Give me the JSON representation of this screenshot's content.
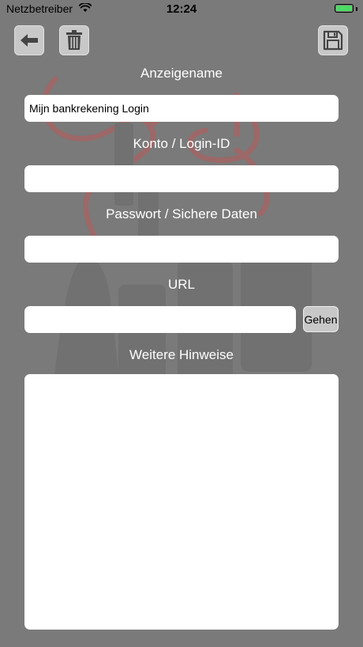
{
  "status_bar": {
    "carrier": "Netzbetreiber",
    "time": "12:24",
    "battery_level": 1.0
  },
  "toolbar": {
    "back_icon": "arrow-left-icon",
    "delete_icon": "trash-icon",
    "save_icon": "floppy-disk-icon"
  },
  "form": {
    "display_name_label": "Anzeigename",
    "display_name_value": "Mijn bankrekening Login",
    "account_label": "Konto / Login-ID",
    "account_value": "",
    "password_label": "Passwort / Sichere Daten",
    "password_value": "",
    "url_label": "URL",
    "url_value": "",
    "go_label": "Gehen",
    "notes_label": "Weitere Hinweise",
    "notes_value": ""
  },
  "colors": {
    "background": "#7a7a7a",
    "button_fill": "#c8c8c8",
    "battery": "#4cd964",
    "art_red": "#b85a5a"
  }
}
